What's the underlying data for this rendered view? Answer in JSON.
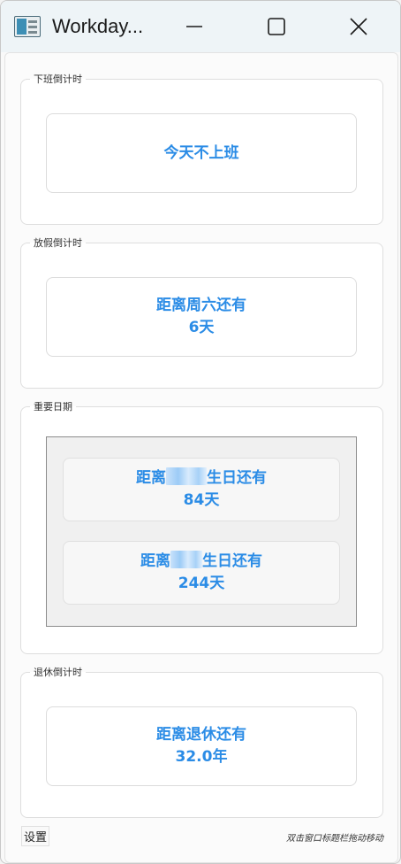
{
  "window": {
    "title": "Workday...",
    "controls": {
      "minimize": "minimize",
      "maximize": "maximize",
      "close": "close"
    }
  },
  "groups": [
    {
      "legend": "下班倒计时",
      "cards": [
        {
          "line1": "今天不上班"
        }
      ]
    },
    {
      "legend": "放假倒计时",
      "cards": [
        {
          "line1": "距离周六还有",
          "line2": "6天"
        }
      ]
    },
    {
      "legend": "重要日期",
      "cards": [
        {
          "prefix": "距离",
          "suffix": "生日还有",
          "line2": "84天"
        },
        {
          "prefix": "距离",
          "suffix": "生日还有",
          "line2": "244天"
        }
      ]
    },
    {
      "legend": "退休倒计时",
      "cards": [
        {
          "line1": "距离退休还有",
          "line2": "32.0年"
        }
      ]
    }
  ],
  "footer": {
    "settings_label": "设置",
    "hint": "双击窗口标题栏拖动移动"
  },
  "colors": {
    "accent_text": "#2b8ce6",
    "titlebar_bg": "#eef4f7"
  },
  "icons": {
    "app": "app-icon",
    "minimize": "minimize-icon",
    "maximize": "maximize-icon",
    "close": "close-icon"
  }
}
